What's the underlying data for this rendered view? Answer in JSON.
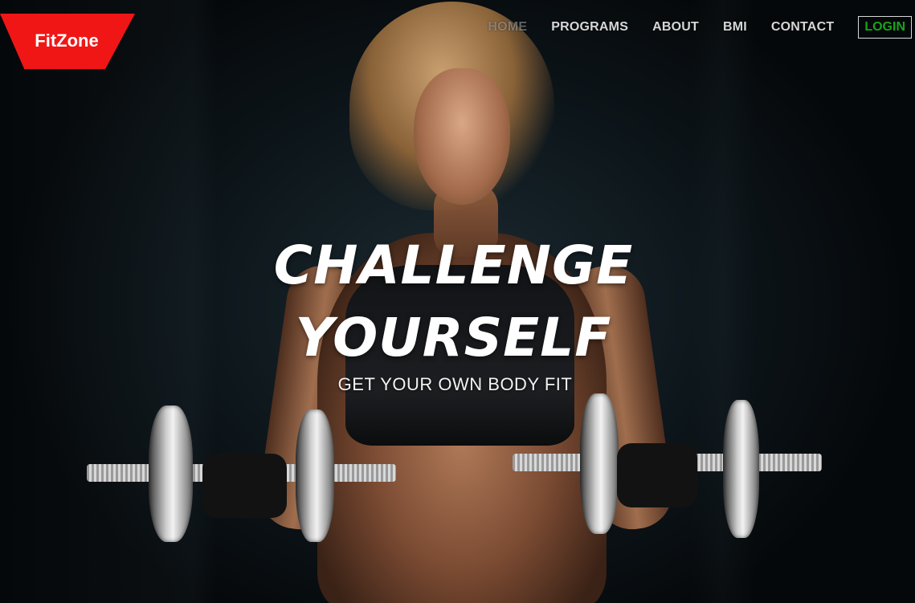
{
  "brand": {
    "logo_text": "FitZone",
    "accent": "#f11616"
  },
  "nav": {
    "items": [
      {
        "label": "HOME"
      },
      {
        "label": "PROGRAMS"
      },
      {
        "label": "ABOUT"
      },
      {
        "label": "BMI"
      },
      {
        "label": "CONTACT"
      }
    ],
    "login_label": "LOGIN",
    "login_color": "#19a319"
  },
  "hero": {
    "headline_line1": "CHALLENGE",
    "headline_line2": "YOURSELF",
    "subheadline": "GET YOUR OWN BODY FIT",
    "background_image": "athlete-lifting-dumbbells"
  }
}
